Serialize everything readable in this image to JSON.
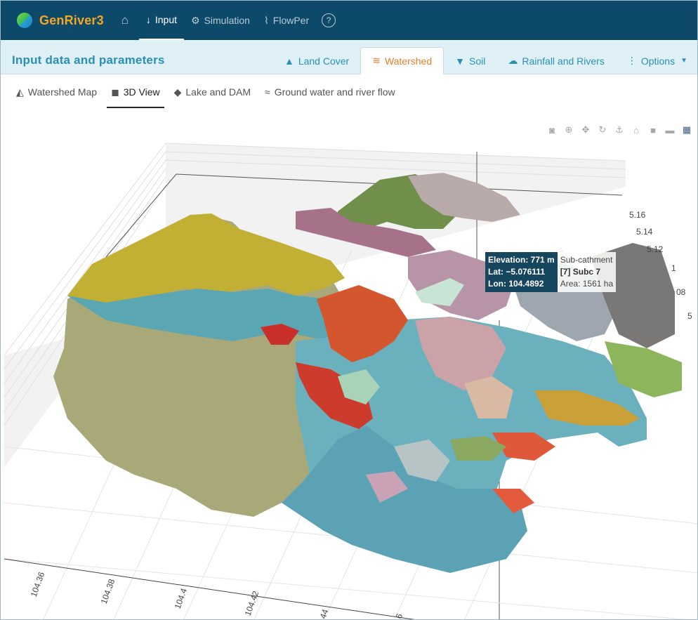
{
  "brand": {
    "name_a": "GenRiver",
    "name_b": "3"
  },
  "nav": {
    "home": "⌂",
    "items": [
      {
        "label": "Input",
        "icon": "↓",
        "active": true
      },
      {
        "label": "Simulation",
        "icon": "⚙"
      },
      {
        "label": "FlowPer",
        "icon": "⌇"
      }
    ],
    "help": "?"
  },
  "section": {
    "title": "Input data and parameters",
    "tabs": [
      {
        "label": "Land Cover",
        "icon": "tree-icon"
      },
      {
        "label": "Watershed",
        "icon": "waves-icon",
        "active": true
      },
      {
        "label": "Soil",
        "icon": "soil-icon"
      },
      {
        "label": "Rainfall and Rivers",
        "icon": "cloud-icon"
      },
      {
        "label": "Options",
        "icon": "dots-icon"
      }
    ]
  },
  "subtabs": [
    {
      "label": "Watershed Map",
      "icon": "mountain-icon"
    },
    {
      "label": "3D View",
      "icon": "cube-icon",
      "active": true
    },
    {
      "label": "Lake and DAM",
      "icon": "fish-icon"
    },
    {
      "label": "Ground water and river flow",
      "icon": "water-icon"
    }
  ],
  "plot": {
    "z_ticks": [
      "5.16",
      "5.14",
      "5.12",
      "1",
      "08",
      "5"
    ],
    "x_ticks": [
      "104.36",
      "104.38",
      "104.4",
      "104.42",
      "44",
      "6"
    ]
  },
  "tooltip": {
    "elevation": "Elevation: 771 m",
    "lat": "Lat: −5.076111",
    "lon": "Lon: 104.4892",
    "title": "Sub-cathment",
    "subc_id": "[7]",
    "subc_name": "Subc 7",
    "area": "Area: 1561 ha"
  }
}
